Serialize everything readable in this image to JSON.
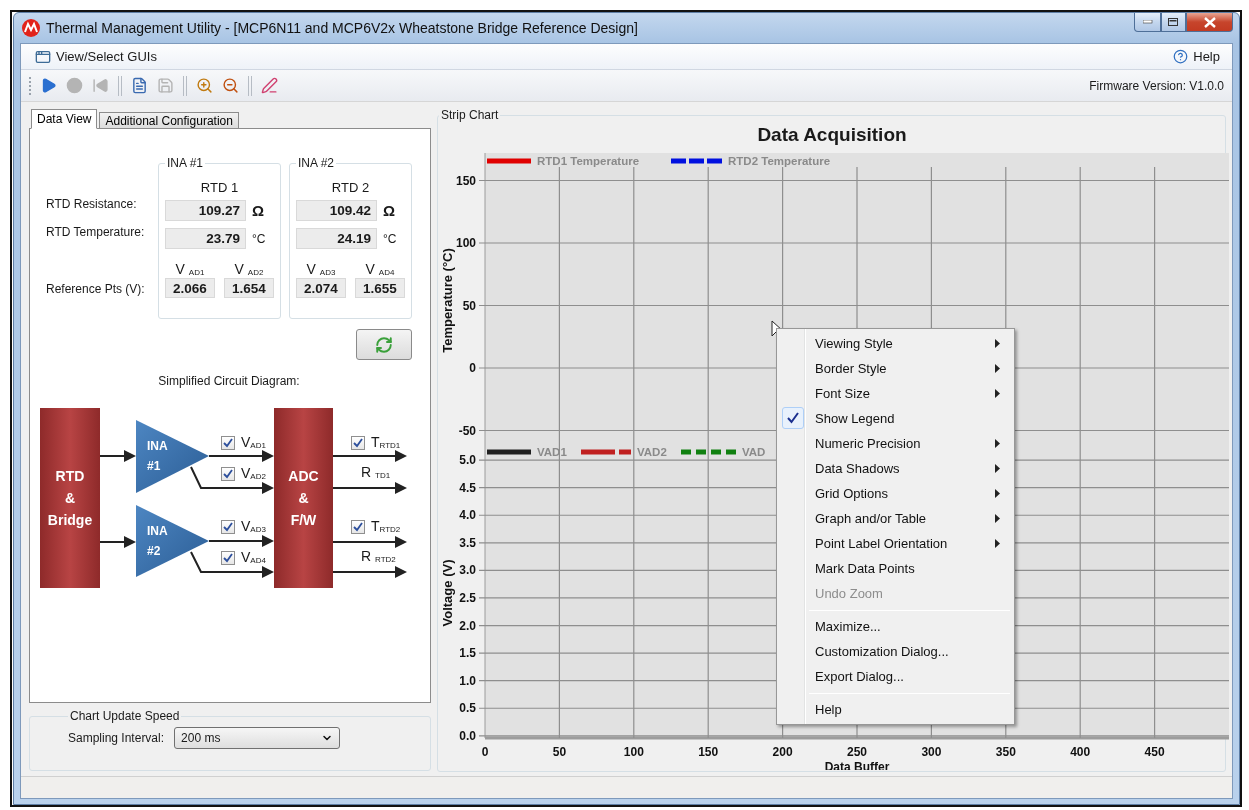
{
  "window": {
    "title": "Thermal Management Utility - [MCP6N11 and MCP6V2x Wheatstone Bridge Reference Design]"
  },
  "menu_bar": {
    "left": "View/Select GUIs",
    "right": "Help"
  },
  "toolbar": {
    "buttons": [
      {
        "disabled": false
      },
      {
        "disabled": true
      },
      {
        "disabled": true
      },
      {
        "disabled": false
      },
      {
        "disabled": true
      },
      {
        "disabled": false
      },
      {
        "disabled": false
      },
      {
        "disabled": false
      }
    ],
    "firmware": "Firmware Version: V1.0.0"
  },
  "tabs": [
    {
      "label": "Data View",
      "selected": true
    },
    {
      "label": "Additional Configuration",
      "selected": false
    }
  ],
  "row_labels": [
    "RTD Resistance:",
    "RTD Temperature:",
    "Reference Pts (V):"
  ],
  "groups": [
    {
      "title": "INA #1",
      "rtd": "RTD 1",
      "resistance": "109.27",
      "resistance_unit": "Ω",
      "temperature": "23.79",
      "temperature_unit": "°C",
      "refs": [
        {
          "label": "V $_{AD1}$",
          "value": "2.066"
        },
        {
          "label": "V $_{AD2}$",
          "value": "1.654"
        }
      ]
    },
    {
      "title": "INA #2",
      "rtd": "RTD 2",
      "resistance": "109.42",
      "resistance_unit": "Ω",
      "temperature": "24.19",
      "temperature_unit": "°C",
      "refs": [
        {
          "label": "V $_{AD3}$",
          "value": "2.074"
        },
        {
          "label": "V $_{AD4}$",
          "value": "1.655"
        }
      ]
    }
  ],
  "diagram": {
    "title": "Simplified Circuit Diagram:",
    "source": "RTD\n&\nBridge",
    "converter": "ADC\n&\nF/W",
    "amplifiers": [
      "INA\n#1",
      "INA\n#2"
    ],
    "signals": [
      {
        "label": "V$_{AD1}$",
        "checked": true
      },
      {
        "label": "V$_{AD2}$",
        "checked": true
      },
      {
        "label": "V$_{AD3}$",
        "checked": true
      },
      {
        "label": "V$_{AD4}$",
        "checked": true
      }
    ],
    "outputs": [
      {
        "kind": "checkbox",
        "label": "T$_{RTD1}$",
        "checked": true
      },
      {
        "kind": "plain",
        "label": "R $_{TD1}$"
      },
      {
        "kind": "checkbox",
        "label": "T$_{RTD2}$",
        "checked": true
      },
      {
        "kind": "plain",
        "label": "R $_{RTD2}$"
      }
    ]
  },
  "speed": {
    "title": "Chart Update Speed",
    "label": "Sampling Interval:",
    "value": "200 ms"
  },
  "strip_chart": {
    "title": "Strip Chart",
    "heading": "Data Acquisition",
    "charts": [
      {
        "chart_data": {
          "type": "line",
          "grid": true,
          "ylabel": "Temperature (°C)",
          "ylim": [
            -64,
            172
          ],
          "yticks": [
            -50,
            0,
            50,
            100,
            150
          ],
          "series": [
            {
              "name": "RTD1 Temperature",
              "color": "#e00000",
              "line_style": "solid"
            },
            {
              "name": "RTD2 Temperature",
              "color": "#0010e0",
              "line_style": "dashed"
            }
          ]
        }
      },
      {
        "chart_data": {
          "type": "line",
          "grid": true,
          "xlabel": "Data Buffer",
          "ylabel": "Voltage (V)",
          "ylim": [
            -0.04,
            5.22
          ],
          "categories": [
            "0",
            "50",
            "100",
            "150",
            "200",
            "250",
            "300",
            "350",
            "400",
            "450"
          ],
          "yticks": [
            {
              "value": 0,
              "label": "0.0"
            },
            {
              "value": 0.5,
              "label": "0.5"
            },
            {
              "value": 1,
              "label": "1.0"
            },
            {
              "value": 1.5,
              "label": "1.5"
            },
            {
              "value": 2,
              "label": "2.0"
            },
            {
              "value": 2.5,
              "label": "2.5"
            },
            {
              "value": 3,
              "label": "3.0"
            },
            {
              "value": 3.5,
              "label": "3.5"
            },
            {
              "value": 4,
              "label": "4.0"
            },
            {
              "value": 4.5,
              "label": "4.5"
            },
            {
              "value": 5,
              "label": "5.0"
            }
          ],
          "series": [
            {
              "name": "VAD1",
              "color": "#202020",
              "line_style": "solid",
              "values": [
                null,
                null,
                null,
                null,
                null,
                null,
                null,
                null,
                null,
                null
              ]
            },
            {
              "name": "VAD2",
              "color": "#c02020",
              "line_style": "long_short",
              "values": [
                null,
                null,
                null,
                null,
                null,
                null,
                null,
                null,
                null,
                null
              ]
            },
            {
              "name": "VAD",
              "color": "#108010",
              "line_style": "dotted",
              "values": [
                null,
                null,
                null,
                null,
                null,
                null,
                null,
                null,
                null,
                null
              ]
            }
          ]
        }
      }
    ]
  },
  "context_menu": [
    {
      "kind": "item",
      "label": "Viewing Style",
      "submenu": true,
      "checked": false,
      "disabled": false
    },
    {
      "kind": "item",
      "label": "Border Style",
      "submenu": true,
      "checked": false,
      "disabled": false
    },
    {
      "kind": "item",
      "label": "Font Size",
      "submenu": true,
      "checked": false,
      "disabled": false
    },
    {
      "kind": "item",
      "label": "Show Legend",
      "submenu": false,
      "checked": true,
      "disabled": false
    },
    {
      "kind": "item",
      "label": "Numeric Precision",
      "submenu": true,
      "checked": false,
      "disabled": false
    },
    {
      "kind": "item",
      "label": "Data Shadows",
      "submenu": true,
      "checked": false,
      "disabled": false
    },
    {
      "kind": "item",
      "label": "Grid Options",
      "submenu": true,
      "checked": false,
      "disabled": false
    },
    {
      "kind": "item",
      "label": "Graph and/or Table",
      "submenu": true,
      "checked": false,
      "disabled": false
    },
    {
      "kind": "item",
      "label": "Point Label Orientation",
      "submenu": true,
      "checked": false,
      "disabled": false
    },
    {
      "kind": "item",
      "label": "Mark Data Points",
      "submenu": false,
      "checked": false,
      "disabled": false
    },
    {
      "kind": "item",
      "label": "Undo Zoom",
      "submenu": false,
      "checked": false,
      "disabled": true
    },
    {
      "kind": "separator"
    },
    {
      "kind": "item",
      "label": "Maximize...",
      "submenu": false,
      "checked": false,
      "disabled": false
    },
    {
      "kind": "item",
      "label": "Customization Dialog...",
      "submenu": false,
      "checked": false,
      "disabled": false
    },
    {
      "kind": "item",
      "label": "Export Dialog...",
      "submenu": false,
      "checked": false,
      "disabled": false
    },
    {
      "kind": "separator"
    },
    {
      "kind": "item",
      "label": "Help",
      "submenu": false,
      "checked": false,
      "disabled": false
    }
  ]
}
